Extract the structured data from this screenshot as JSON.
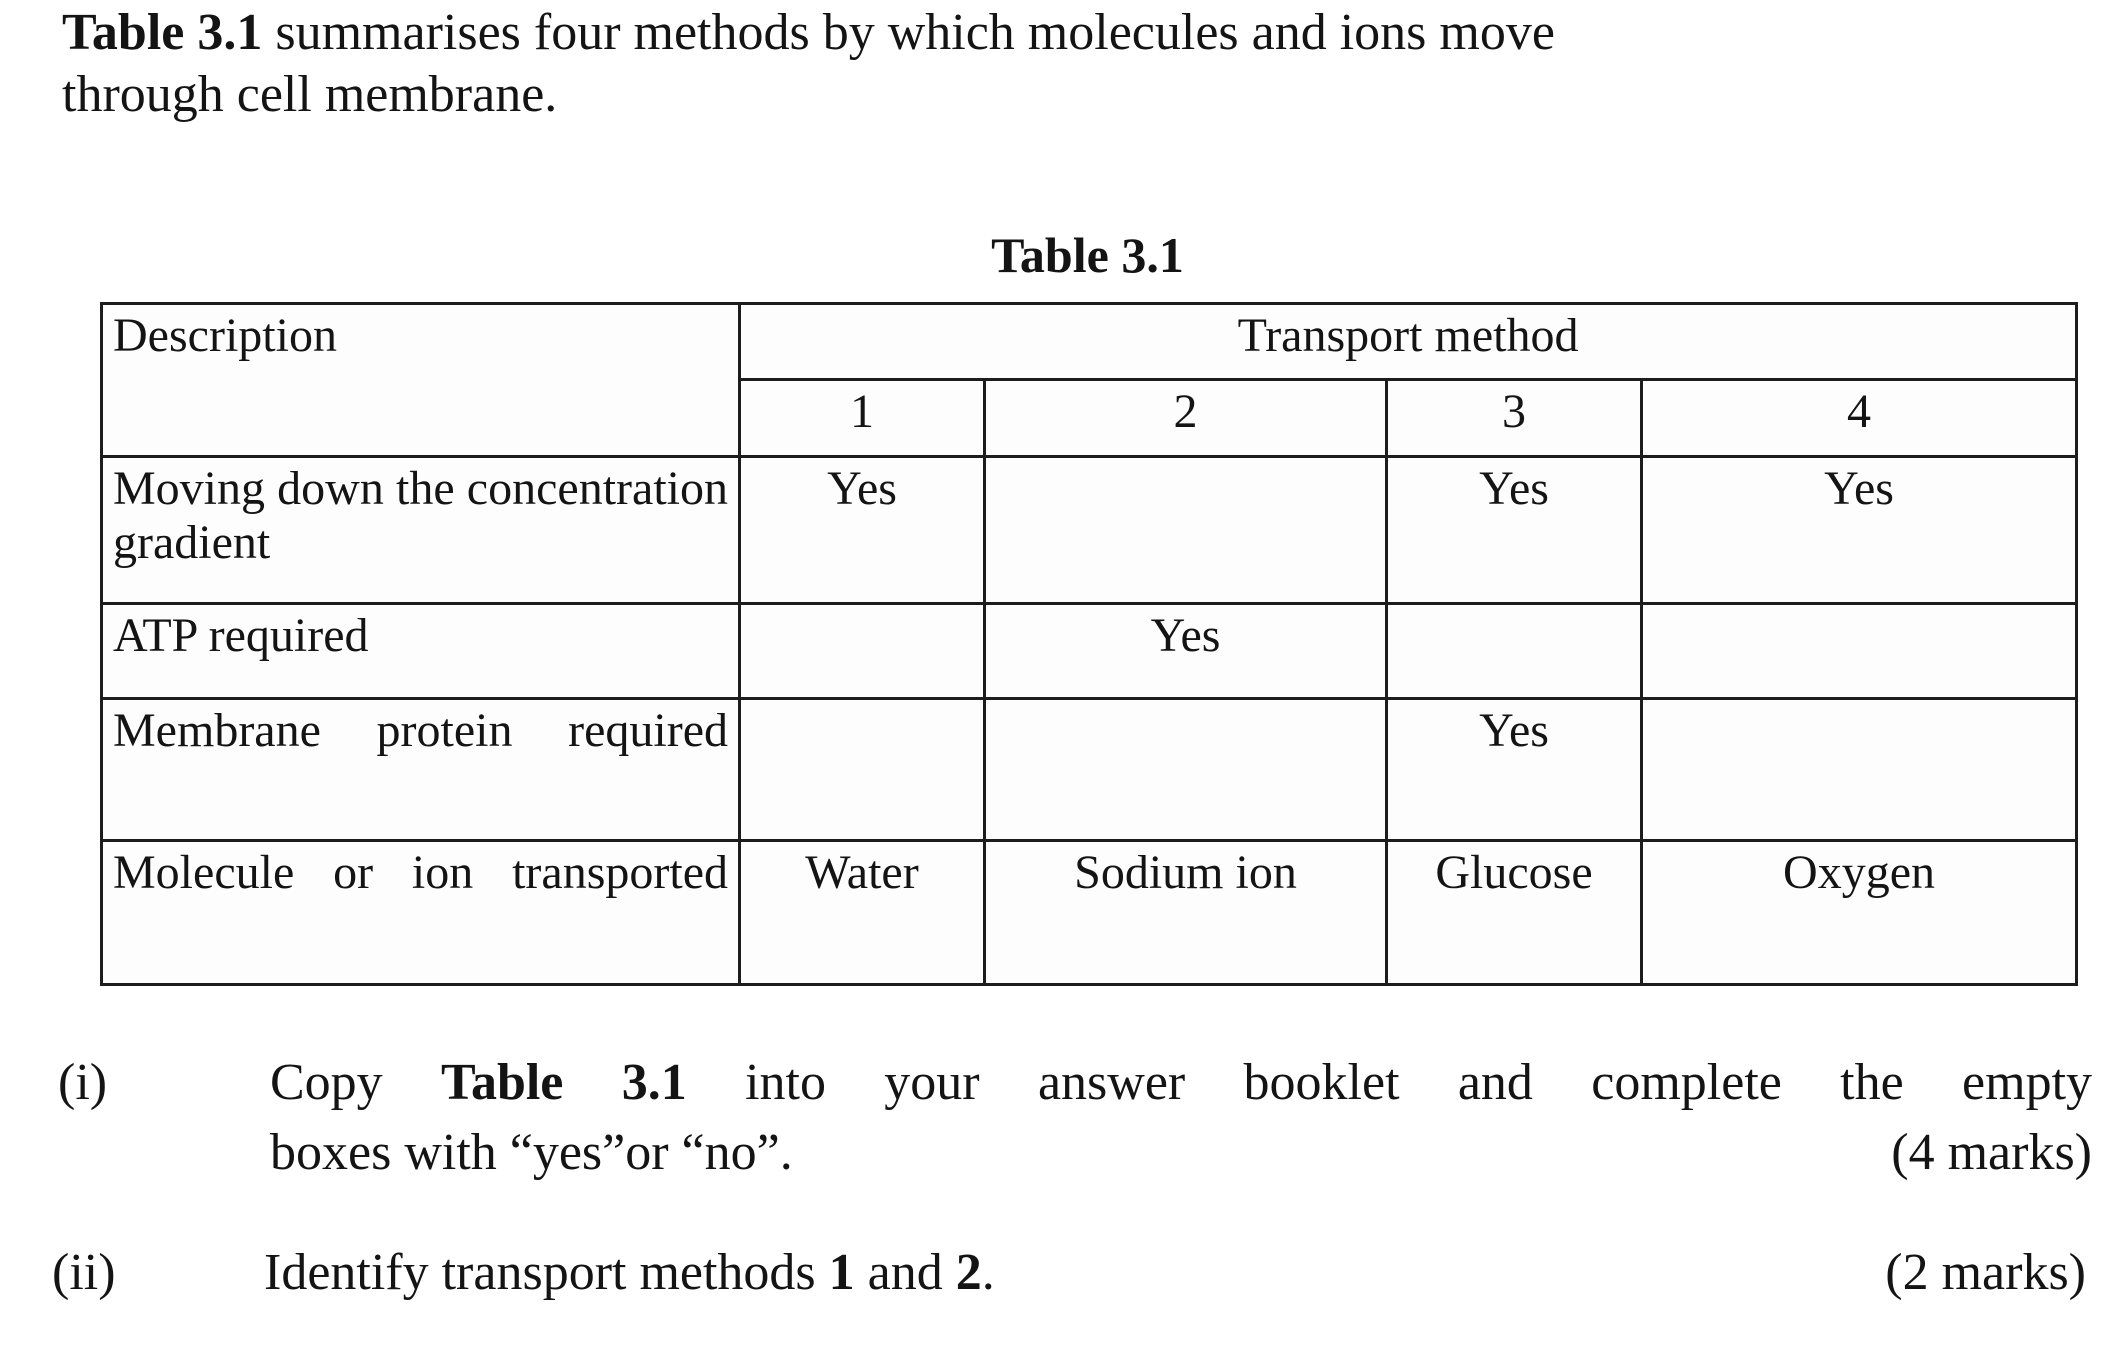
{
  "intro": {
    "bold_prefix": "Table 3.1",
    "line1_rest": "summarises four methods by which molecules and ions move",
    "line2": "through cell membrane."
  },
  "table": {
    "caption": "Table 3.1",
    "header": {
      "description_label": "Description",
      "group_label": "Transport method",
      "columns": [
        "1",
        "2",
        "3",
        "4"
      ]
    },
    "rows": [
      {
        "description": "Moving down the concentration gradient",
        "values": [
          "Yes",
          "",
          "Yes",
          "Yes"
        ]
      },
      {
        "description": "ATP required",
        "values": [
          "",
          "Yes",
          "",
          ""
        ]
      },
      {
        "description": "Membrane protein required",
        "values": [
          "",
          "",
          "Yes",
          ""
        ]
      },
      {
        "description": "Molecule or ion transported",
        "values": [
          "Water",
          "Sodium ion",
          "Glucose",
          "Oxygen"
        ]
      }
    ]
  },
  "questions": [
    {
      "marker": "(i)",
      "text_before_bold": "Copy ",
      "bold_ref": "Table 3.1",
      "text_after_bold": " into your answer booklet and complete the empty",
      "line2": "boxes with “yes”or “no”.",
      "marks": "(4 marks)"
    },
    {
      "marker": "(ii)",
      "text_before_bold": "Identify transport methods ",
      "bold_ref": "1",
      "text_mid": " and ",
      "bold_ref2": "2",
      "text_after_bold": ".",
      "marks": "(2 marks)"
    }
  ]
}
